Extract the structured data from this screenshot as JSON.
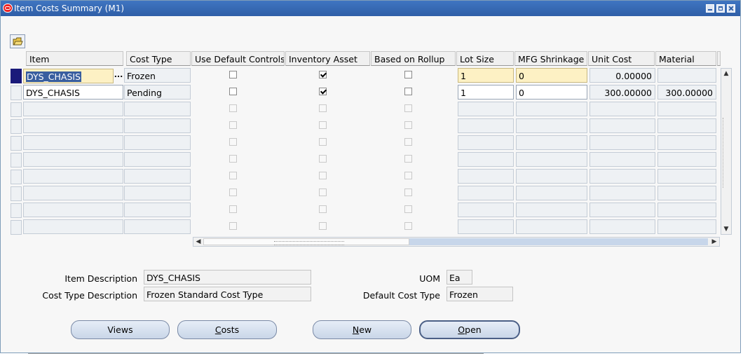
{
  "window": {
    "title": "Item Costs Summary (M1)"
  },
  "columns": [
    "Item",
    "Cost Type",
    "Use Default Controls",
    "Inventory Asset",
    "Based on Rollup",
    "Lot Size",
    "MFG Shrinkage",
    "Unit Cost",
    "Material"
  ],
  "rows": [
    {
      "item": "DYS_CHASIS",
      "cost_type": "Frozen",
      "use_default": false,
      "inventory_asset": true,
      "based_on_rollup": false,
      "lot_size": "1",
      "mfg_shrinkage": "0",
      "unit_cost": "0.00000",
      "material": ""
    },
    {
      "item": "DYS_CHASIS",
      "cost_type": "Pending",
      "use_default": false,
      "inventory_asset": true,
      "based_on_rollup": false,
      "lot_size": "1",
      "mfg_shrinkage": "0",
      "unit_cost": "300.00000",
      "material": "300.00000"
    }
  ],
  "lov_glyph": "...",
  "details": {
    "item_description_label": "Item Description",
    "item_description": "DYS_CHASIS",
    "cost_type_description_label": "Cost Type Description",
    "cost_type_description": "Frozen Standard Cost Type",
    "uom_label": "UOM",
    "uom": "Ea",
    "default_cost_type_label": "Default Cost Type",
    "default_cost_type": "Frozen"
  },
  "buttons": {
    "views": "Views",
    "costs_mnemonic": "C",
    "costs_rest": "osts",
    "new_mnemonic": "N",
    "new_rest": "ew",
    "open_mnemonic": "O",
    "open_rest": "pen"
  },
  "scroll": {
    "up": "▲",
    "down": "▼",
    "left": "◀",
    "right": "▶"
  },
  "colors": {
    "titlebar": "#2f5fa7",
    "active_field": "#fdf1c4",
    "selection": "#385e9f",
    "button": "#c9d6e8"
  }
}
